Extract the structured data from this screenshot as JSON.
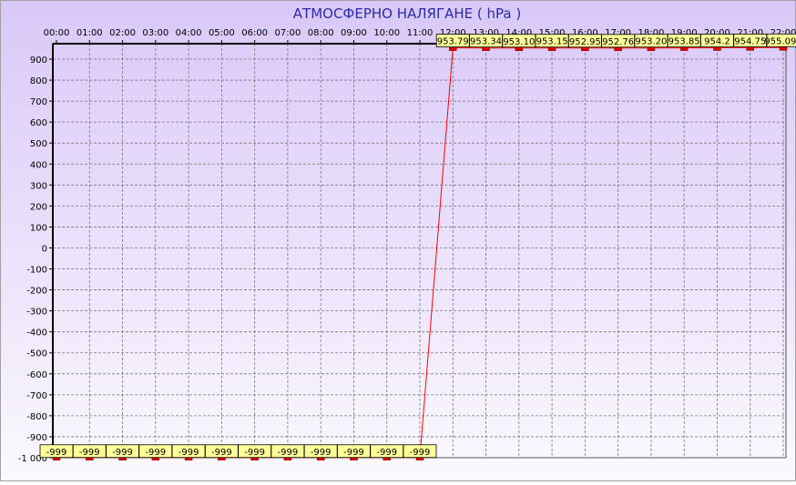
{
  "chart_data": {
    "type": "line",
    "title": "АТМОСФЕРНО НАЛЯГАНЕ  ( hPa )",
    "x": [
      "00:00",
      "01:00",
      "02:00",
      "03:00",
      "04:00",
      "05:00",
      "06:00",
      "07:00",
      "08:00",
      "09:00",
      "10:00",
      "11:00",
      "12:00",
      "13:00",
      "14:00",
      "15:00",
      "16:00",
      "17:00",
      "18:00",
      "19:00",
      "20:00",
      "21:00",
      "22:00"
    ],
    "values": [
      -999,
      -999,
      -999,
      -999,
      -999,
      -999,
      -999,
      -999,
      -999,
      -999,
      -999,
      -999,
      953.79,
      953.34,
      953.1,
      953.15,
      952.95,
      952.76,
      953.2,
      953.85,
      954.2,
      954.75,
      955.09
    ],
    "data_labels": [
      "-999",
      "-999",
      "-999",
      "-999",
      "-999",
      "-999",
      "-999",
      "-999",
      "-999",
      "-999",
      "-999",
      "-999",
      "953.79",
      "953.34",
      "953.10",
      "953.15",
      "952.95",
      "952.76",
      "953.20",
      "953.85",
      "954.2",
      "954.75",
      "955.094"
    ],
    "y_ticks": [
      "900",
      "800",
      "700",
      "600",
      "500",
      "400",
      "300",
      "200",
      "100",
      "0",
      "-100",
      "-200",
      "-300",
      "-400",
      "-500",
      "-600",
      "-700",
      "-800",
      "-900",
      "-1 000"
    ],
    "ylim": [
      -1000,
      900
    ],
    "grid": true,
    "colors": {
      "line": "#ff0000",
      "marker": "#dd0000",
      "label_bg": "#ffff99",
      "title": "#2a2aa8",
      "background_top": "#d9c8f8",
      "background_bottom": "#fbf9fe",
      "grid": "#777777"
    }
  }
}
